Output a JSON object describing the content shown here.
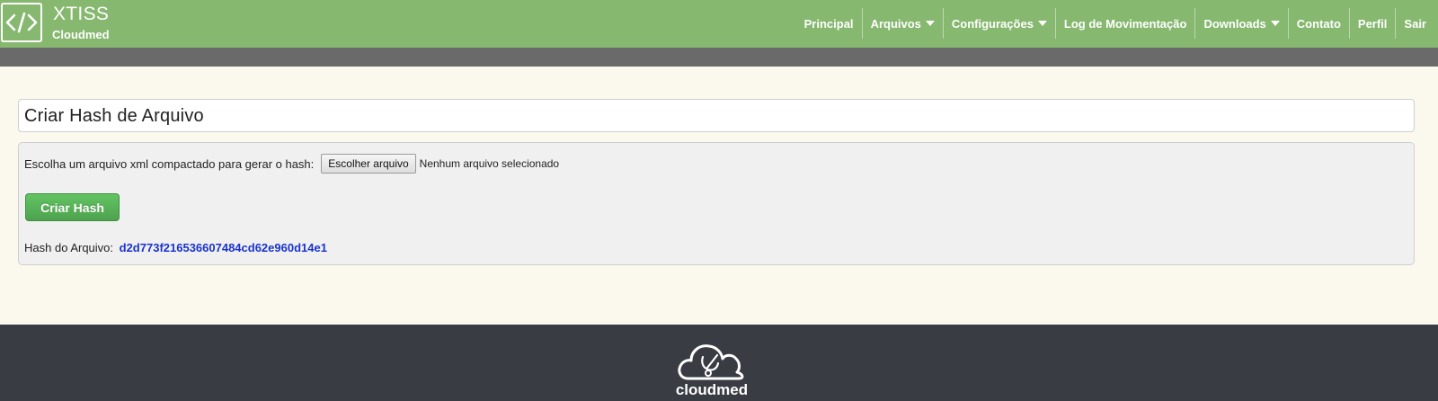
{
  "brand": {
    "logo_glyph": "</>",
    "title": "XTISS",
    "subtitle": "Cloudmed"
  },
  "nav": {
    "items": [
      {
        "label": "Principal",
        "dropdown": false
      },
      {
        "label": "Arquivos",
        "dropdown": true
      },
      {
        "label": "Configurações",
        "dropdown": true
      },
      {
        "label": "Log de Movimentação",
        "dropdown": false
      },
      {
        "label": "Downloads",
        "dropdown": true
      },
      {
        "label": "Contato",
        "dropdown": false
      },
      {
        "label": "Perfil",
        "dropdown": false
      },
      {
        "label": "Sair",
        "dropdown": false
      }
    ]
  },
  "page": {
    "title": "Criar Hash de Arquivo"
  },
  "form": {
    "file_label": "Escolha um arquivo xml compactado para gerar o hash:",
    "file_button": "Escolher arquivo",
    "file_status": "Nenhum arquivo selecionado",
    "submit_label": "Criar Hash",
    "hash_label": "Hash do Arquivo:",
    "hash_value": "d2d773f216536607484cd62e960d14e1"
  },
  "footer": {
    "logo_icon": "cloud-stethoscope-icon",
    "brand_text": "cloudmed"
  },
  "colors": {
    "header_green": "#86b86f",
    "subbar_gray": "#6a6a6a",
    "page_background": "#fbf9ee",
    "button_green": "#5cb85c",
    "hash_blue": "#1a33cc",
    "footer_dark": "#393c43"
  }
}
